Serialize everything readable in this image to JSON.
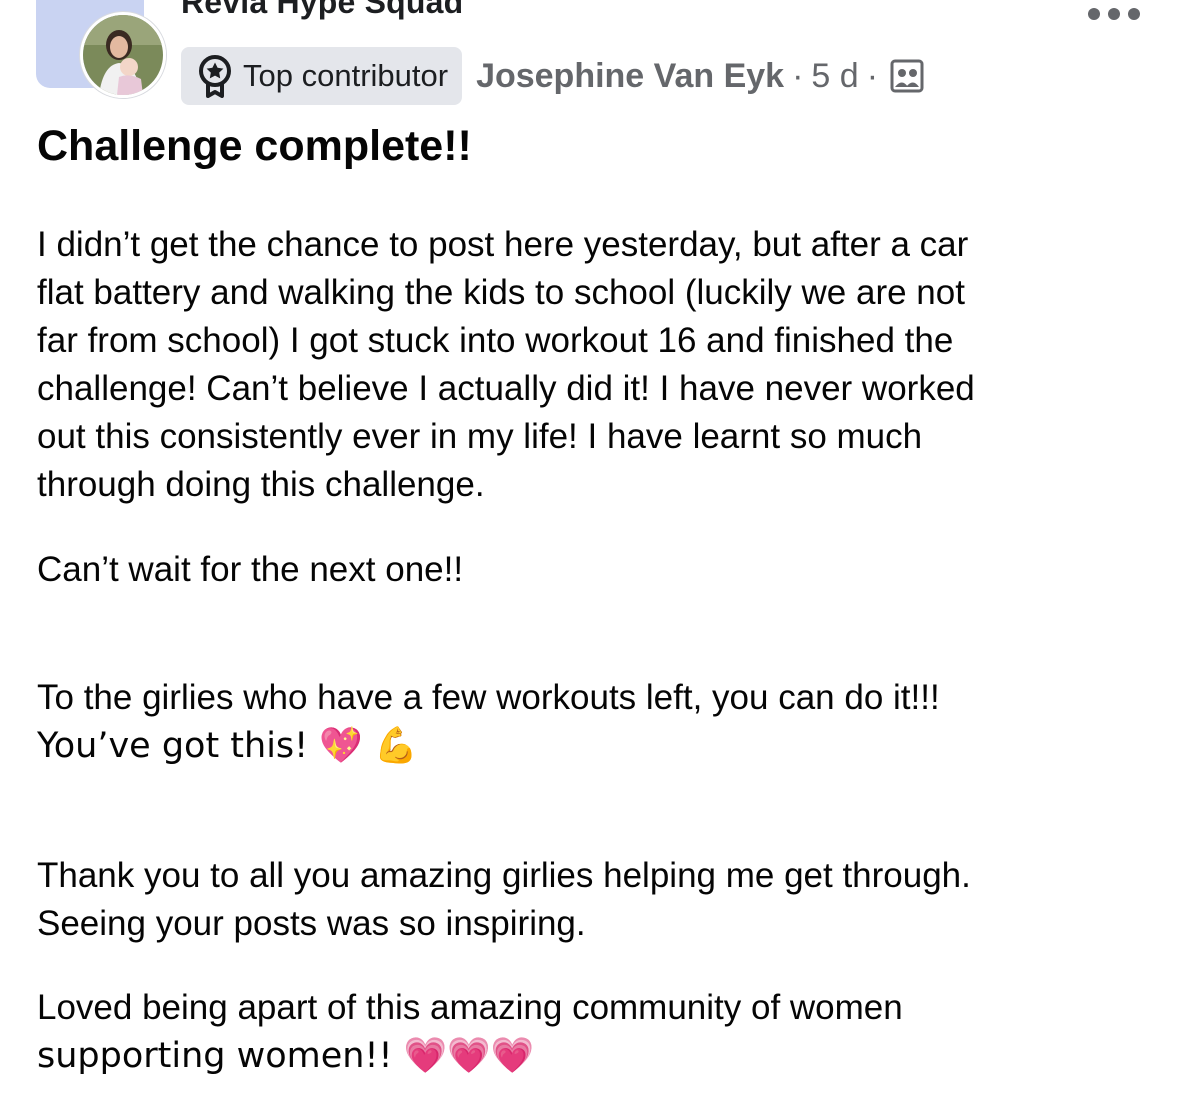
{
  "post": {
    "group_name": "Revia Hype Squad",
    "badge": {
      "label": "Top contributor",
      "icon": "badge-icon"
    },
    "author": "Josephine Van Eyk",
    "separator": "·",
    "time": "5 d",
    "audience_icon": "group-audience-icon",
    "more_icon": "more-options-icon",
    "title": "Challenge complete!!",
    "paragraphs": [
      {
        "lines": [
          "I didn’t get the chance to post here yesterday, but after a car",
          "flat battery and walking the kids to school (luckily we are not",
          "far from school) I got stuck into workout 16 and finished the",
          "challenge! Can’t believe I actually did it! I have never worked",
          "out this consistently ever in my life! I have learnt so much",
          "through doing this challenge."
        ]
      },
      {
        "lines": [
          "Can’t wait for the next one!!"
        ]
      },
      {
        "lines": [
          "To the girlies who have a few workouts left, you can do it!!!",
          "You’ve got this! 💖 💪"
        ]
      },
      {
        "lines": [
          "Thank you to all you amazing girlies helping me get through.",
          "Seeing your posts was so inspiring."
        ]
      },
      {
        "lines": [
          "Loved being apart of this amazing community of women",
          "supporting women!! 💗💗💗"
        ]
      }
    ]
  },
  "colors": {
    "background": "#ffffff",
    "text_primary": "#050505",
    "text_secondary": "#65676b",
    "badge_bg": "#e4e6eb",
    "group_thumb": "#c9d3f2"
  }
}
